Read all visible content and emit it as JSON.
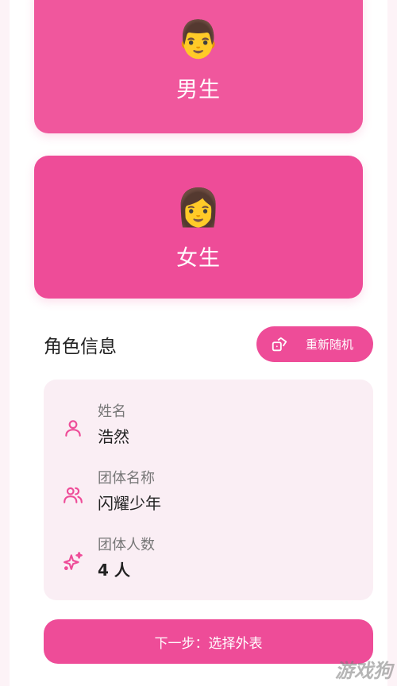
{
  "gender_options": [
    {
      "emoji": "👨",
      "label": "男生"
    },
    {
      "emoji": "👩",
      "label": "女生"
    }
  ],
  "character_info": {
    "title": "角色信息",
    "reroll_button": "重新随机",
    "fields": [
      {
        "icon": "user-icon",
        "label": "姓名",
        "value": "浩然"
      },
      {
        "icon": "users-icon",
        "label": "团体名称",
        "value": "闪耀少年"
      },
      {
        "icon": "sparkle-icon",
        "label": "团体人数",
        "value": "4 人"
      }
    ]
  },
  "next_button": "下一步：选择外表",
  "watermark": "游戏狗",
  "colors": {
    "accent": "#ee4c98",
    "panel": "#faeef4"
  }
}
